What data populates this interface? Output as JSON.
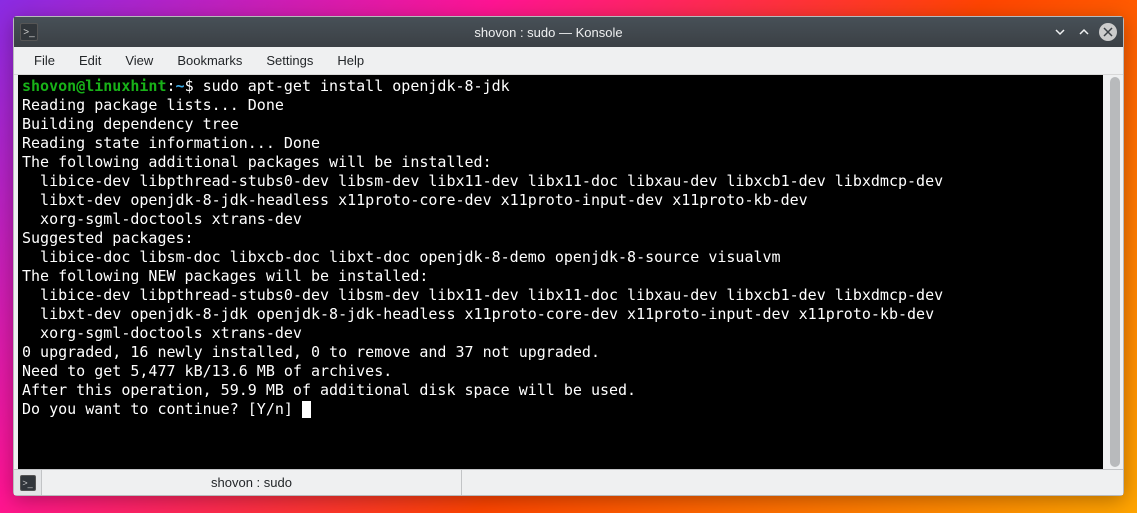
{
  "window": {
    "title": "shovon : sudo — Konsole"
  },
  "menubar": {
    "file": "File",
    "edit": "Edit",
    "view": "View",
    "bookmarks": "Bookmarks",
    "settings": "Settings",
    "help": "Help"
  },
  "prompt": {
    "user": "shovon",
    "at": "@",
    "host": "linuxhint",
    "colon": ":",
    "path": "~",
    "dollar": "$",
    "command": " sudo apt-get install openjdk-8-jdk"
  },
  "output": {
    "l1": "Reading package lists... Done",
    "l2": "Building dependency tree       ",
    "l3": "Reading state information... Done",
    "l4": "The following additional packages will be installed:",
    "l5": "  libice-dev libpthread-stubs0-dev libsm-dev libx11-dev libx11-doc libxau-dev libxcb1-dev libxdmcp-dev",
    "l6": "  libxt-dev openjdk-8-jdk-headless x11proto-core-dev x11proto-input-dev x11proto-kb-dev",
    "l7": "  xorg-sgml-doctools xtrans-dev",
    "l8": "Suggested packages:",
    "l9": "  libice-doc libsm-doc libxcb-doc libxt-doc openjdk-8-demo openjdk-8-source visualvm",
    "l10": "The following NEW packages will be installed:",
    "l11": "  libice-dev libpthread-stubs0-dev libsm-dev libx11-dev libx11-doc libxau-dev libxcb1-dev libxdmcp-dev",
    "l12": "  libxt-dev openjdk-8-jdk openjdk-8-jdk-headless x11proto-core-dev x11proto-input-dev x11proto-kb-dev",
    "l13": "  xorg-sgml-doctools xtrans-dev",
    "l14": "0 upgraded, 16 newly installed, 0 to remove and 37 not upgraded.",
    "l15": "Need to get 5,477 kB/13.6 MB of archives.",
    "l16": "After this operation, 59.9 MB of additional disk space will be used.",
    "l17": "Do you want to continue? [Y/n] "
  },
  "tabbar": {
    "tab1": "shovon : sudo"
  }
}
